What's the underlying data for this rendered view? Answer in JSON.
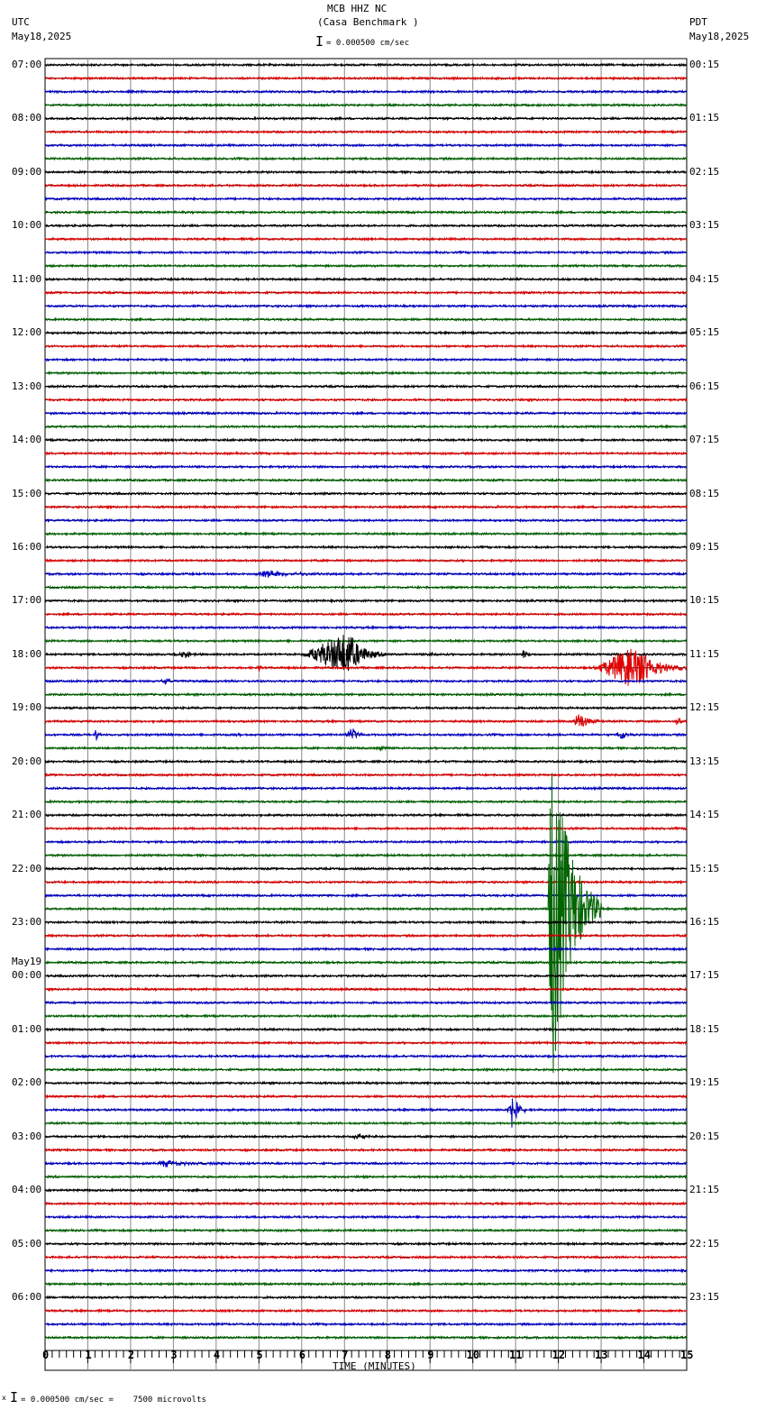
{
  "header": {
    "title": "MCB HHZ NC",
    "subtitle": "(Casa Benchmark )",
    "left_tz": "UTC",
    "left_date": "May18,2025",
    "right_tz": "PDT",
    "right_date": "May18,2025",
    "scale_text": "= 0.000500 cm/sec"
  },
  "footer": {
    "scale_text": "= 0.000500 cm/sec =    7500 microvolts",
    "mark": "x"
  },
  "chart_data": {
    "type": "line",
    "title": "MCB HHZ NC (Casa Benchmark )",
    "xlabel": "TIME (MINUTES)",
    "xlim": [
      0,
      15
    ],
    "x_ticks": [
      "0",
      "1",
      "2",
      "3",
      "4",
      "5",
      "6",
      "7",
      "8",
      "9",
      "10",
      "11",
      "12",
      "13",
      "14",
      "15"
    ],
    "minor_tick_seconds": 10,
    "traces_per_hour": 4,
    "trace_colors": [
      "#000000",
      "#e00000",
      "#0000c8",
      "#006400"
    ],
    "left_labels": [
      "07:00",
      "08:00",
      "09:00",
      "10:00",
      "11:00",
      "12:00",
      "13:00",
      "14:00",
      "15:00",
      "16:00",
      "17:00",
      "18:00",
      "19:00",
      "20:00",
      "21:00",
      "22:00",
      "23:00",
      "00:00",
      "01:00",
      "02:00",
      "03:00",
      "04:00",
      "05:00",
      "06:00"
    ],
    "date_change": {
      "hour_index": 17,
      "label": "May19"
    },
    "right_labels": [
      "00:15",
      "01:15",
      "02:15",
      "03:15",
      "04:15",
      "05:15",
      "06:15",
      "07:15",
      "08:15",
      "09:15",
      "10:15",
      "11:15",
      "12:15",
      "13:15",
      "14:15",
      "15:15",
      "16:15",
      "17:15",
      "18:15",
      "19:15",
      "20:15",
      "21:15",
      "22:15",
      "23:15"
    ],
    "events": [
      {
        "trace": 44,
        "start": 2.9,
        "peak": 3.3,
        "end": 3.8,
        "amp": 0.2
      },
      {
        "trace": 44,
        "start": 6.0,
        "peak": 7.1,
        "end": 8.0,
        "amp": 1.3
      },
      {
        "trace": 44,
        "start": 8.9,
        "peak": 9.0,
        "end": 9.2,
        "amp": 0.15
      },
      {
        "trace": 44,
        "start": 11.15,
        "peak": 11.2,
        "end": 11.35,
        "amp": 0.5
      },
      {
        "trace": 45,
        "start": 4.95,
        "peak": 5.0,
        "end": 5.05,
        "amp": 0.3
      },
      {
        "trace": 45,
        "start": 12.8,
        "peak": 13.8,
        "end": 15.0,
        "amp": 1.3
      },
      {
        "trace": 46,
        "start": 2.7,
        "peak": 2.85,
        "end": 3.1,
        "amp": 0.2
      },
      {
        "trace": 38,
        "start": 4.8,
        "peak": 5.2,
        "end": 7.0,
        "amp": 0.2
      },
      {
        "trace": 49,
        "start": 12.3,
        "peak": 12.5,
        "end": 13.1,
        "amp": 0.5
      },
      {
        "trace": 49,
        "start": 14.75,
        "peak": 14.8,
        "end": 14.9,
        "amp": 0.7
      },
      {
        "trace": 50,
        "start": 1.15,
        "peak": 1.2,
        "end": 1.3,
        "amp": 0.4
      },
      {
        "trace": 50,
        "start": 4.45,
        "peak": 4.5,
        "end": 4.6,
        "amp": 0.25
      },
      {
        "trace": 50,
        "start": 7.0,
        "peak": 7.2,
        "end": 7.5,
        "amp": 0.4
      },
      {
        "trace": 50,
        "start": 13.3,
        "peak": 13.5,
        "end": 13.8,
        "amp": 0.3
      },
      {
        "trace": 51,
        "start": 7.7,
        "peak": 7.9,
        "end": 8.1,
        "amp": 0.15
      },
      {
        "trace": 63,
        "start": 11.75,
        "peak": 11.85,
        "end": 13.0,
        "amp": 10.5
      },
      {
        "trace": 78,
        "start": 10.8,
        "peak": 10.9,
        "end": 11.3,
        "amp": 1.2
      },
      {
        "trace": 78,
        "start": 4.25,
        "peak": 4.3,
        "end": 4.35,
        "amp": 0.2
      },
      {
        "trace": 80,
        "start": 7.1,
        "peak": 7.3,
        "end": 7.9,
        "amp": 0.15
      },
      {
        "trace": 82,
        "start": 2.6,
        "peak": 2.8,
        "end": 4.2,
        "amp": 0.2
      }
    ]
  }
}
